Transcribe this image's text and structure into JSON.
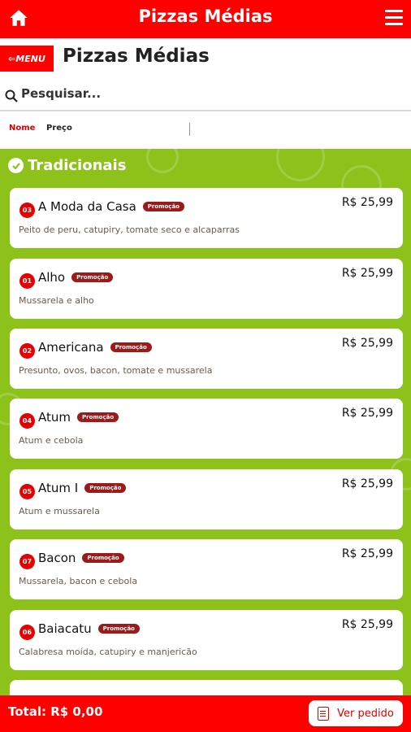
{
  "topbar": {
    "title": "Pizzas Médias",
    "home_icon": "home-icon",
    "menu_icon": "hamburger-icon"
  },
  "header": {
    "menu_label": "MENU",
    "title": "Pizzas Médias"
  },
  "search": {
    "placeholder": "Pesquisar..."
  },
  "sort": {
    "name_label": "Nome",
    "price_label": "Preço"
  },
  "section": {
    "title": "Tradicionais"
  },
  "products": [
    {
      "num": "03",
      "name": "A Moda da Casa",
      "badge": "Promoção",
      "price": "R$ 25,99",
      "desc": "Peito de peru, catupiry, tomate seco e alcaparras"
    },
    {
      "num": "01",
      "name": "Alho",
      "badge": "Promoção",
      "price": "R$ 25,99",
      "desc": "Mussarela e alho"
    },
    {
      "num": "02",
      "name": "Americana",
      "badge": "Promoção",
      "price": "R$ 25,99",
      "desc": "Presunto, ovos, bacon, tomate e mussarela"
    },
    {
      "num": "04",
      "name": "Atum",
      "badge": "Promoção",
      "price": "R$ 25,99",
      "desc": "Atum e cebola"
    },
    {
      "num": "05",
      "name": "Atum I",
      "badge": "Promoção",
      "price": "R$ 25,99",
      "desc": "Atum e mussarela"
    },
    {
      "num": "07",
      "name": "Bacon",
      "badge": "Promoção",
      "price": "R$ 25,99",
      "desc": "Mussarela, bacon e cebola"
    },
    {
      "num": "06",
      "name": "Baiacatu",
      "badge": "Promoção",
      "price": "R$ 25,99",
      "desc": "Calabresa moída, catupiry e manjericão"
    }
  ],
  "footer": {
    "total": "Total: R$ 0,00",
    "order_button": "Ver pedido"
  },
  "colors": {
    "brand_red": "#ff0000",
    "background_green": "#8cc21a",
    "badge_red": "#9b1a1a"
  }
}
